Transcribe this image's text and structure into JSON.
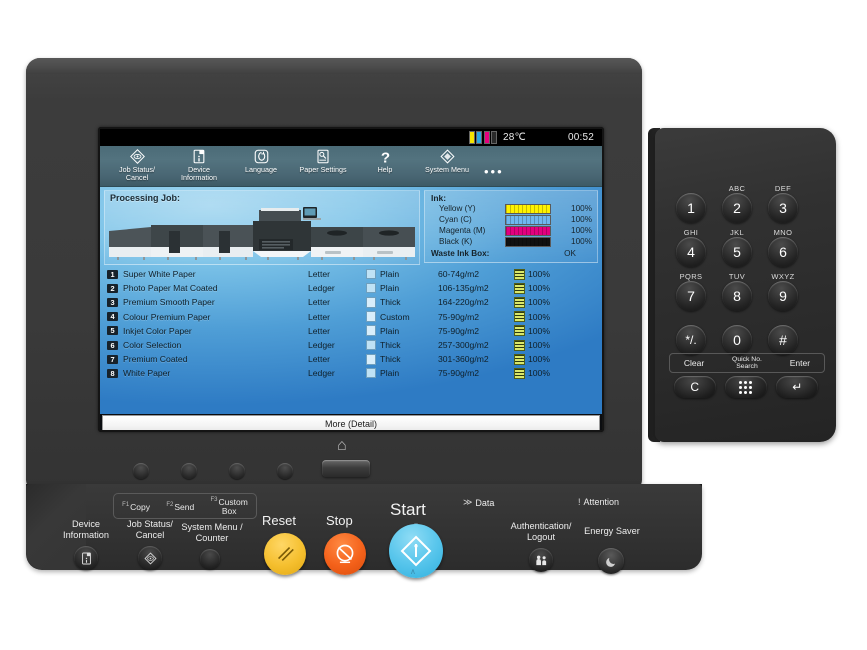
{
  "device": {
    "name": "multifunction-printer-control-panel"
  },
  "screen": {
    "statusbar": {
      "ink_indicator": "ink-levels-icon",
      "temperature": "28℃",
      "time": "00:52"
    },
    "toolbar": {
      "items": [
        {
          "label": "Job Status/\nCancel",
          "label_line1": "Job Status/",
          "label_line2": "Cancel",
          "icon": "job-status-diamond-icon"
        },
        {
          "label": "Device Information",
          "label_line1": "Device",
          "label_line2": "Information",
          "icon": "device-information-icon"
        },
        {
          "label": "Language",
          "label_line1": "Language",
          "label_line2": "",
          "icon": "language-globe-icon"
        },
        {
          "label": "Paper Settings",
          "label_line1": "Paper Settings",
          "label_line2": "",
          "icon": "paper-settings-icon"
        },
        {
          "label": "Help",
          "label_line1": "Help",
          "label_line2": "",
          "icon": "help-question-icon"
        },
        {
          "label": "System Menu",
          "label_line1": "System Menu",
          "label_line2": "",
          "icon": "system-menu-diamond-icon"
        }
      ],
      "overflow": "•••"
    },
    "job": {
      "title": "Processing Job:",
      "illustration": "production-press-illustration"
    },
    "ink": {
      "heading": "Ink:",
      "rows": [
        {
          "name": "Yellow (Y)",
          "percent": "100%",
          "color": "#fff200"
        },
        {
          "name": "Cyan (C)",
          "percent": "100%",
          "color": "#6fb7ef"
        },
        {
          "name": "Magenta (M)",
          "percent": "100%",
          "color": "#e2007f"
        },
        {
          "name": "Black (K)",
          "percent": "100%",
          "color": "#111111"
        }
      ],
      "waste_label": "Waste Ink Box:",
      "waste_value": "OK"
    },
    "paper_list": {
      "rows": [
        {
          "num": "1",
          "name": "Super White Paper",
          "size": "Letter",
          "type": "Plain",
          "weight": "60-74g/m2",
          "level": "100%"
        },
        {
          "num": "2",
          "name": "Photo Paper Mat Coated",
          "size": "Ledger",
          "type": "Plain",
          "weight": "106-135g/m2",
          "level": "100%"
        },
        {
          "num": "3",
          "name": "Premium Smooth Paper",
          "size": "Letter",
          "type": "Thick",
          "weight": "164-220g/m2",
          "level": "100%"
        },
        {
          "num": "4",
          "name": "Colour Premium Paper",
          "size": "Letter",
          "type": "Custom",
          "weight": "75-90g/m2",
          "level": "100%"
        },
        {
          "num": "5",
          "name": "Inkjet Color Paper",
          "size": "Letter",
          "type": "Plain",
          "weight": "75-90g/m2",
          "level": "100%"
        },
        {
          "num": "6",
          "name": "Color Selection",
          "size": "Ledger",
          "type": "Thick",
          "weight": "257-300g/m2",
          "level": "100%"
        },
        {
          "num": "7",
          "name": "Premium Coated",
          "size": "Letter",
          "type": "Thick",
          "weight": "301-360g/m2",
          "level": "100%"
        },
        {
          "num": "8",
          "name": "White Paper",
          "size": "Ledger",
          "type": "Plain",
          "weight": "75-90g/m2",
          "level": "100%"
        }
      ]
    },
    "more_button": "More (Detail)"
  },
  "fkeys": [
    {
      "fn": "F1",
      "label": "Copy"
    },
    {
      "fn": "F2",
      "label": "Send"
    },
    {
      "fn": "F3",
      "label": "Custom Box",
      "line1": "Custom",
      "line2": "Box"
    }
  ],
  "chin": {
    "buttons": [
      {
        "label_line1": "Device",
        "label_line2": "Information",
        "icon": "device-information-icon"
      },
      {
        "label_line1": "Job Status/",
        "label_line2": "Cancel",
        "icon": "job-status-diamond-icon"
      },
      {
        "label_line1": "System Menu /",
        "label_line2": "Counter",
        "icon": "system-menu-counter-icon"
      }
    ],
    "reset": "Reset",
    "stop": "Stop",
    "start": "Start",
    "auth_line1": "Authentication/",
    "auth_line2": "Logout",
    "energy_saver": "Energy Saver",
    "data_indicator": "Data",
    "attention_indicator": "Attention",
    "attention_mark": "!"
  },
  "keypad": {
    "keys": [
      {
        "digit": "1",
        "letters": ""
      },
      {
        "digit": "2",
        "letters": "ABC"
      },
      {
        "digit": "3",
        "letters": "DEF"
      },
      {
        "digit": "4",
        "letters": "GHI"
      },
      {
        "digit": "5",
        "letters": "JKL"
      },
      {
        "digit": "6",
        "letters": "MNO"
      },
      {
        "digit": "7",
        "letters": "PQRS"
      },
      {
        "digit": "8",
        "letters": "TUV"
      },
      {
        "digit": "9",
        "letters": "WXYZ"
      },
      {
        "digit": "*/.",
        "letters": ""
      },
      {
        "digit": "0",
        "letters": ""
      },
      {
        "digit": "#",
        "letters": ""
      }
    ],
    "clear_label": "Clear",
    "quick_label_line1": "Quick No.",
    "quick_label_line2": "Search",
    "enter_label": "Enter",
    "clear_key": "C",
    "quick_key": "quick-search-grid-icon",
    "enter_key": "↵"
  }
}
